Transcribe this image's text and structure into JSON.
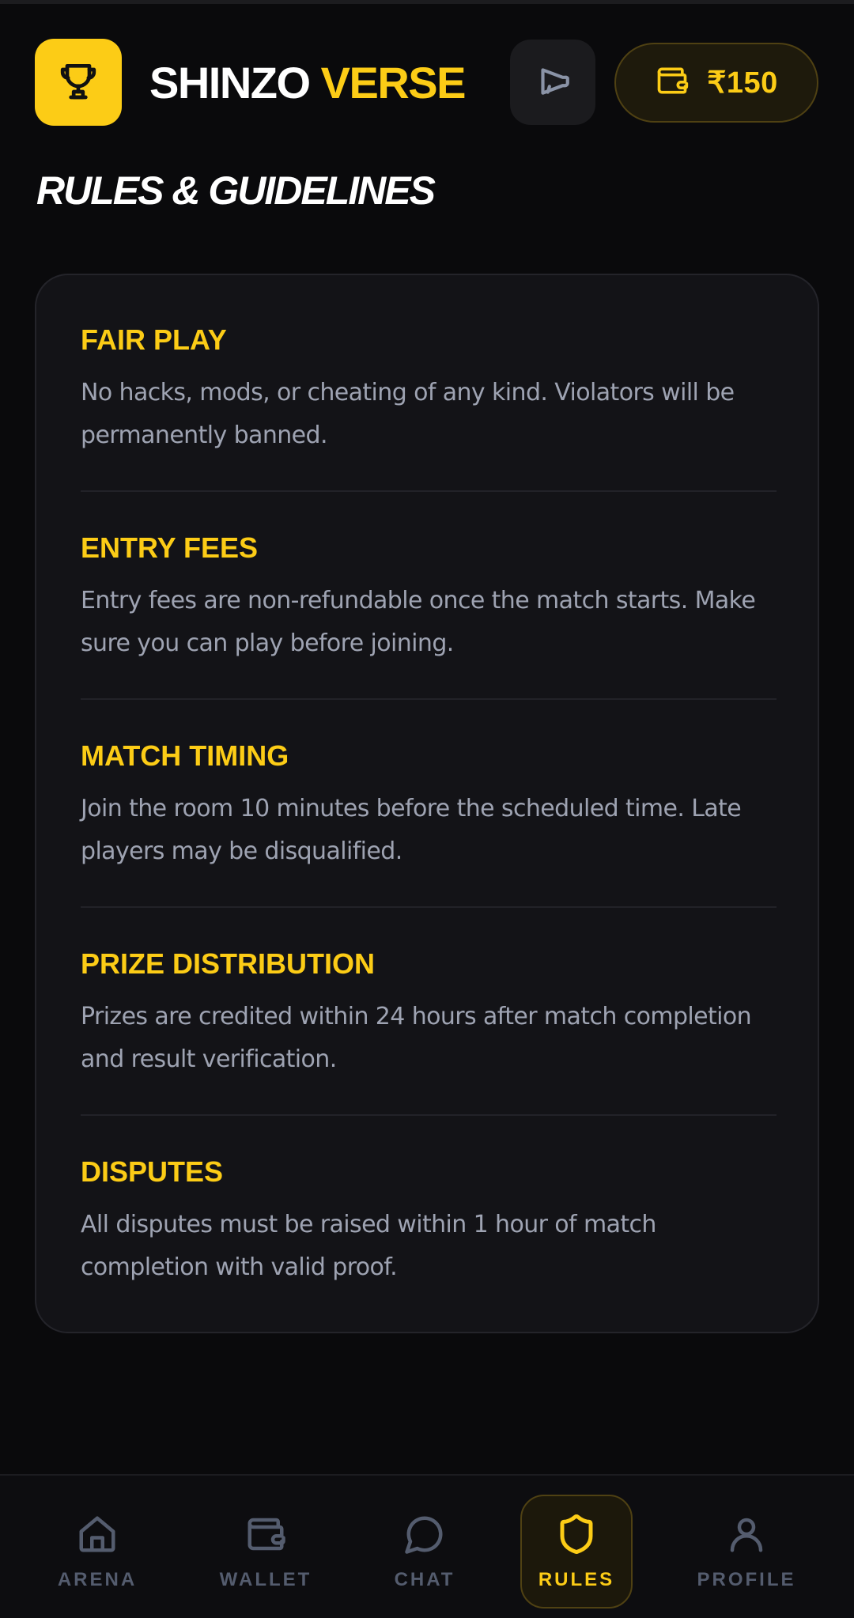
{
  "header": {
    "brand_part1": "SHINZO",
    "brand_part2": "VERSE",
    "logo_icon": "trophy-icon",
    "announce_icon": "megaphone-icon",
    "wallet_icon": "wallet-icon",
    "wallet_balance": "₹150"
  },
  "page": {
    "title": "RULES & GUIDELINES"
  },
  "rules": [
    {
      "title": "FAIR PLAY",
      "description": "No hacks, mods, or cheating of any kind. Violators will be permanently banned."
    },
    {
      "title": "ENTRY FEES",
      "description": "Entry fees are non-refundable once the match starts. Make sure you can play before joining."
    },
    {
      "title": "MATCH TIMING",
      "description": "Join the room 10 minutes before the scheduled time. Late players may be disqualified."
    },
    {
      "title": "PRIZE DISTRIBUTION",
      "description": "Prizes are credited within 24 hours after match completion and result verification."
    },
    {
      "title": "DISPUTES",
      "description": "All disputes must be raised within 1 hour of match completion with valid proof."
    }
  ],
  "nav": {
    "items": [
      {
        "label": "ARENA",
        "icon": "home-icon",
        "active": false
      },
      {
        "label": "WALLET",
        "icon": "wallet-icon",
        "active": false
      },
      {
        "label": "CHAT",
        "icon": "chat-bubble-icon",
        "active": false
      },
      {
        "label": "RULES",
        "icon": "shield-icon",
        "active": true
      },
      {
        "label": "PROFILE",
        "icon": "user-icon",
        "active": false
      }
    ]
  },
  "colors": {
    "background": "#0a0a0c",
    "accent": "#fccc16",
    "card": "#131317",
    "muted_text": "#9ea3b2",
    "nav_inactive": "#545c6e"
  }
}
